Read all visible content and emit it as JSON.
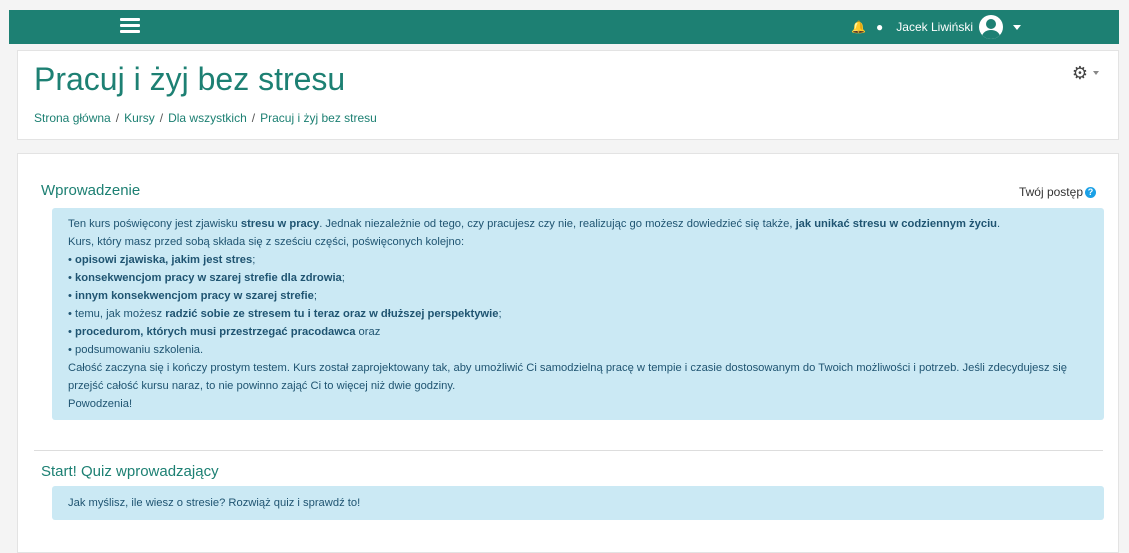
{
  "navbar": {
    "user_name": "Jacek Liwiński",
    "bell_icon": "bell-icon",
    "chat_icon": "chat-icon"
  },
  "header": {
    "title": "Pracuj i żyj bez stresu",
    "breadcrumb": [
      "Strona główna",
      "Kursy",
      "Dla wszystkich",
      "Pracuj i żyj bez stresu"
    ],
    "separator": "/"
  },
  "intro": {
    "title": "Wprowadzenie",
    "progress_label": "Twój postęp",
    "p1_a": "Ten kurs poświęcony jest zjawisku ",
    "p1_b": "stresu w pracy",
    "p1_c": ". Jednak niezależnie od tego, czy pracujesz czy nie, realizując go możesz dowiedzieć się także, ",
    "p1_d": "jak unikać stresu w codziennym życiu",
    "p1_e": ".",
    "p2": "Kurs, który masz przed sobą składa się z sześciu części, poświęconych kolejno:",
    "li1": "opisowi zjawiska, jakim jest stres",
    "li1_end": ";",
    "li2": "konsekwencjom pracy w szarej strefie dla zdrowia",
    "li2_end": ";",
    "li3": "innym konsekwencjom pracy w szarej strefie",
    "li3_end": ";",
    "li4_a": "temu, jak możesz ",
    "li4_b": "radzić sobie ze stresem tu i teraz oraz w dłuższej perspektywie",
    "li4_end": ";",
    "li5": "procedurom, których musi przestrzegać pracodawca",
    "li5_end": " oraz",
    "li6": "podsumowaniu szkolenia.",
    "p3": "Całość zaczyna się i kończy prostym testem. Kurs został zaprojektowany tak, aby umożliwić Ci samodzielną pracę w tempie i czasie dostosowanym do Twoich możliwości i potrzeb. Jeśli zdecydujesz się przejść całość kursu naraz, to nie powinno zająć Ci to więcej niż dwie godziny.",
    "p4": "Powodzenia!"
  },
  "quiz": {
    "title": "Start! Quiz wprowadzający",
    "text": "Jak myślisz, ile wiesz o stresie? Rozwiąż quiz i sprawdź to!"
  }
}
